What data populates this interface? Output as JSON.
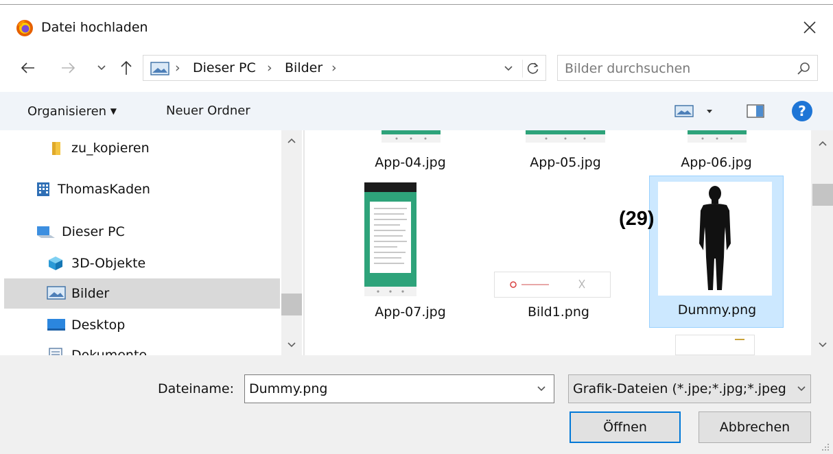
{
  "window": {
    "title": "Datei hochladen",
    "app_icon": "firefox-icon",
    "close_icon": "close-icon"
  },
  "navigation": {
    "back_icon": "arrow-left-icon",
    "forward_icon": "arrow-right-icon",
    "recent_icon": "chevron-down-icon",
    "up_icon": "arrow-up-icon",
    "breadcrumbs": [
      "Dieser PC",
      "Bilder"
    ],
    "refresh_icon": "refresh-icon",
    "search_placeholder": "Bilder durchsuchen"
  },
  "toolbar": {
    "organize_label": "Organisieren",
    "new_folder_label": "Neuer Ordner",
    "view_icon": "view-options-icon",
    "preview_icon": "preview-pane-icon",
    "help_icon": "help-icon"
  },
  "sidebar": {
    "items": [
      {
        "label": "zu_kopieren",
        "icon": "folder-icon",
        "selected": false
      },
      {
        "label": "ThomasKaden",
        "icon": "network-building-icon",
        "selected": false
      },
      {
        "label": "Dieser PC",
        "icon": "computer-icon",
        "selected": false
      },
      {
        "label": "3D-Objekte",
        "icon": "cube-3d-icon",
        "selected": false
      },
      {
        "label": "Bilder",
        "icon": "pictures-icon",
        "selected": true
      },
      {
        "label": "Desktop",
        "icon": "desktop-icon",
        "selected": false
      },
      {
        "label": "Dokumente",
        "icon": "documents-icon",
        "selected": false
      }
    ]
  },
  "files": [
    {
      "name": "App-04.jpg",
      "thumb": "app-screenshot",
      "selected": false
    },
    {
      "name": "App-05.jpg",
      "thumb": "app-screenshot",
      "selected": false
    },
    {
      "name": "App-06.jpg",
      "thumb": "app-screenshot",
      "selected": false
    },
    {
      "name": "App-07.jpg",
      "thumb": "app-screenshot-full",
      "selected": false
    },
    {
      "name": "Bild1.png",
      "thumb": "wide-banner",
      "selected": false
    },
    {
      "name": "Dummy.png",
      "thumb": "human-silhouette",
      "selected": true
    }
  ],
  "annotation": "(29)",
  "bottom": {
    "filename_label": "Dateiname:",
    "filename_value": "Dummy.png",
    "filetype_value": "Grafik-Dateien (*.jpe;*.jpg;*.jpeg",
    "open_label": "Öffnen",
    "cancel_label": "Abbrechen"
  },
  "colors": {
    "accent": "#0078d7",
    "selection_bg": "#cce8ff",
    "selection_border": "#99d1ff",
    "toolbar_bg": "#f0f4f9",
    "help_blue": "#1e75d6"
  }
}
